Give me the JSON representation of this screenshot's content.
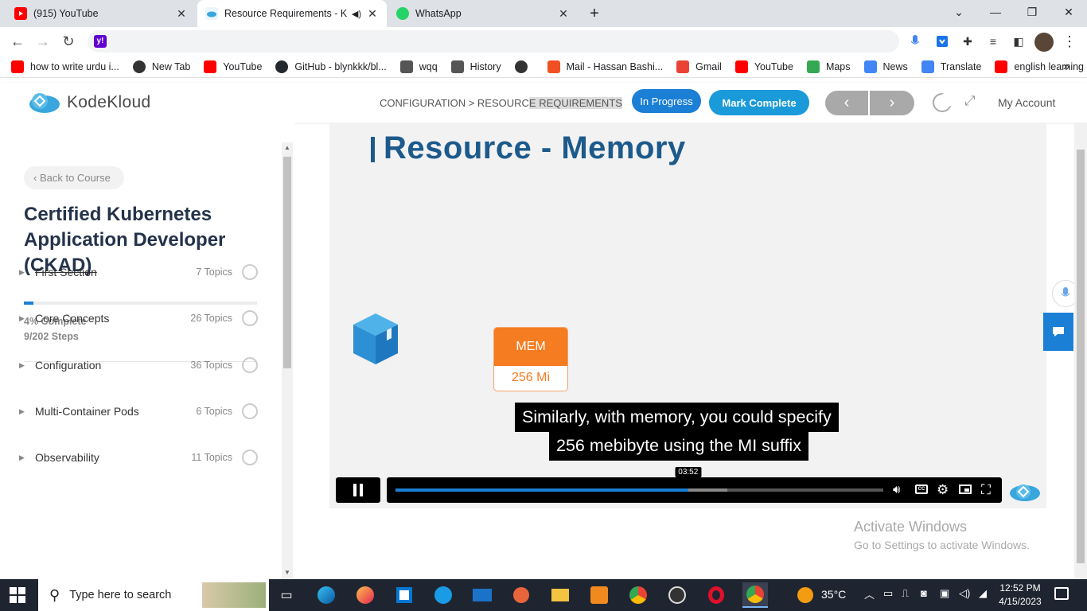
{
  "browser": {
    "tabs": [
      {
        "title": "(915) YouTube",
        "active": false
      },
      {
        "title": "Resource Requirements - Ko",
        "active": true
      },
      {
        "title": "WhatsApp",
        "active": false
      }
    ],
    "new_tab": "+",
    "address": "",
    "bookmarks": [
      {
        "label": "how to write urdu i...",
        "icon": "youtube-icon"
      },
      {
        "label": "New Tab",
        "icon": "globe-icon"
      },
      {
        "label": "YouTube",
        "icon": "youtube-icon"
      },
      {
        "label": "GitHub - blynkkk/bl...",
        "icon": "github-icon"
      },
      {
        "label": "wqq",
        "icon": "download-icon"
      },
      {
        "label": "History",
        "icon": "history-icon"
      },
      {
        "label": "",
        "icon": "globe-icon"
      },
      {
        "label": "Mail - Hassan Bashi...",
        "icon": "microsoft-icon"
      },
      {
        "label": "Gmail",
        "icon": "gmail-icon"
      },
      {
        "label": "YouTube",
        "icon": "youtube-icon"
      },
      {
        "label": "Maps",
        "icon": "maps-icon"
      },
      {
        "label": "News",
        "icon": "news-icon"
      },
      {
        "label": "Translate",
        "icon": "translate-icon"
      },
      {
        "label": "english learning",
        "icon": "youtube-icon"
      }
    ],
    "more": "»"
  },
  "header": {
    "brand": "KodeKloud",
    "breadcrumb_a": "CONFIGURATION > RESOURC",
    "breadcrumb_b": "E REQUIREMENTS",
    "status": "In Progress",
    "mark_complete": "Mark Complete",
    "prev": "‹",
    "next": "›",
    "account": "My Account"
  },
  "sidebar": {
    "back": "‹  Back to Course",
    "course_title": "Certified Kubernetes Application Developer (CKAD)",
    "progress_percent": 4,
    "complete_text": "4% Complete",
    "steps_text": "9/202 Steps",
    "topics": [
      {
        "name": "First Section",
        "count": "7 Topics",
        "strike": true
      },
      {
        "name": "Core Concepts",
        "count": "26 Topics",
        "strike": false
      },
      {
        "name": "Configuration",
        "count": "36 Topics",
        "strike": false
      },
      {
        "name": "Multi-Container Pods",
        "count": "6 Topics",
        "strike": false
      },
      {
        "name": "Observability",
        "count": "11 Topics",
        "strike": false
      }
    ]
  },
  "video": {
    "slide_title": "Resource - Memory",
    "mem_label": "MEM",
    "mem_value": "256 Mi",
    "caption_line1": "Similarly, with memory, you could specify",
    "caption_line2": "256 mebibyte using the MI suffix",
    "time_tooltip": "03:52",
    "played_fraction": 0.6,
    "buffered_fraction": 0.68
  },
  "watermark": {
    "line1": "Activate Windows",
    "line2": "Go to Settings to activate Windows."
  },
  "taskbar": {
    "search_placeholder": "Type here to search",
    "temperature": "35°C",
    "time": "12:52 PM",
    "date": "4/15/2023"
  },
  "colors": {
    "accent": "#1b7fd6",
    "mark_complete": "#1a9ad9",
    "mem_orange": "#f57c20",
    "slide_title": "#1d5a8c"
  }
}
